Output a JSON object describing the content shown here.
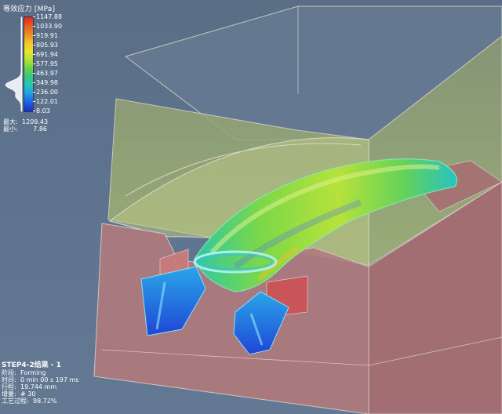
{
  "legend": {
    "title": "等效应力 [MPa]",
    "ticks": [
      "1147.88",
      "1033.90",
      "919.91",
      "805.93",
      "691.94",
      "577.95",
      "463.97",
      "349.98",
      "236.00",
      "122.01",
      "8.03"
    ],
    "max_label": "最大:",
    "max_value": "1209.43",
    "min_label": "最小:",
    "min_value": "7.86",
    "histogram_peak_fraction_from_top": 0.72
  },
  "info": {
    "title": "STEP4-2结果 - 1",
    "rows": [
      {
        "label": "阶段:",
        "value": "Forming"
      },
      {
        "label": "时间:",
        "value": "0 min 00 s 197 ms"
      },
      {
        "label": "行程:",
        "value": "19.744 mm"
      },
      {
        "label": "增量:",
        "value": "# 30"
      },
      {
        "label": "工艺过程:",
        "value": "98.72%"
      }
    ]
  },
  "colors": {
    "background": "#5f7590",
    "upper_die": "#9caf6e",
    "lower_die": "#b07a7c",
    "die_edges": "#c8c8b8",
    "part_max": "#e2281c",
    "part_mid": "#6fd24a",
    "part_min": "#1e2fc9"
  }
}
